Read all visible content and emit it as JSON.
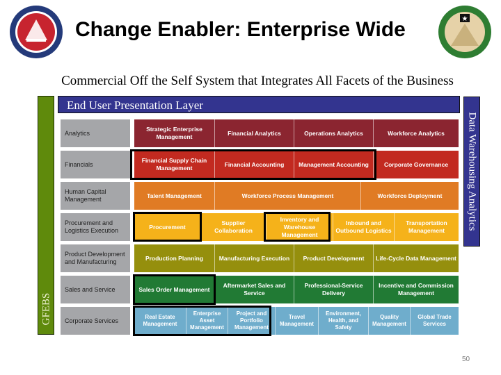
{
  "header": {
    "title": "Change Enabler: Enterprise Wide",
    "left_logo": "assistant-secretary-of-the-army-seal",
    "right_logo": "us-army-program-management-seal"
  },
  "subtitle": "Commercial Off the Self System that Integrates All Facets of the Business",
  "presentation_layer": "End User Presentation Layer",
  "side_labels": {
    "left": "GFEBS",
    "right": "Data Warehousing Analytics"
  },
  "colors": {
    "analytics": "#8b2530",
    "financials": "#c22a20",
    "human_capital": "#e07b24",
    "procurement": "#f5b21a",
    "product_dev": "#958f0d",
    "sales": "#217a34",
    "corporate": "#6fadcc",
    "row_label": "#a5a6a9",
    "presentation": "#33348f",
    "gfebs": "#5f8a0c"
  },
  "rows": [
    {
      "label": "Analytics",
      "color": "#8b2530",
      "cells": [
        "Strategic Enterprise Management",
        "Financial Analytics",
        "Operations Analytics",
        "Workforce Analytics"
      ]
    },
    {
      "label": "Financials",
      "color": "#c22a20",
      "cells": [
        "Financial Supply Chain Management",
        "Financial Accounting",
        "Management Accounting",
        "Corporate Governance"
      ]
    },
    {
      "label": "Human Capital Management",
      "color": "#e07b24",
      "cells": [
        "Talent Management",
        "Workforce Process Management",
        "Workforce Deployment"
      ]
    },
    {
      "label": "Procurement and Logistics Execution",
      "color": "#f5b21a",
      "cells": [
        "Procurement",
        "Supplier Collaboration",
        "Inventory and Warehouse Management",
        "Inbound and Outbound Logistics",
        "Transportation Management"
      ]
    },
    {
      "label": "Product Development and Manufacturing",
      "color": "#958f0d",
      "cells": [
        "Production Planning",
        "Manufacturing Execution",
        "Product Development",
        "Life-Cycle Data Management"
      ]
    },
    {
      "label": "Sales and Service",
      "color": "#217a34",
      "cells": [
        "Sales Order Management",
        "Aftermarket Sales and Service",
        "Professional-Service Delivery",
        "Incentive and Commission Management"
      ]
    },
    {
      "label": "Corporate Services",
      "color": "#6fadcc",
      "cells": [
        "Real Estate Management",
        "Enterprise Asset Management",
        "Project and Portfolio Management",
        "Travel Management",
        "Environment, Health, and Safety",
        "Quality Management",
        "Global Trade Services"
      ]
    }
  ],
  "highlighted_in_scope": [
    "Financial Supply Chain Management",
    "Financial Accounting",
    "Management Accounting",
    "Procurement",
    "Inventory and Warehouse Management",
    "Sales Order Management",
    "Real Estate Management",
    "Enterprise Asset Management",
    "Project and Portfolio Management"
  ],
  "page_number": "50"
}
